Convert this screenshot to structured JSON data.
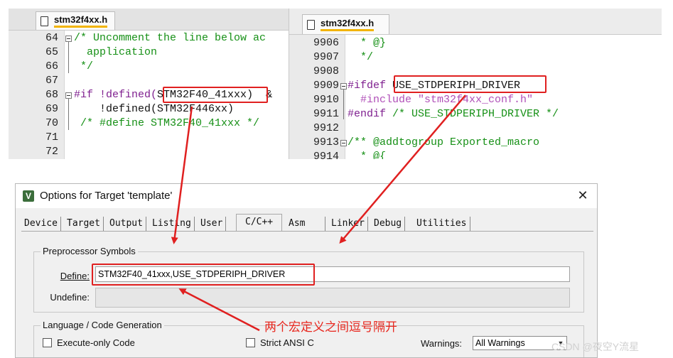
{
  "left_editor": {
    "tab": "stm32f4xx.h",
    "line_numbers": [
      "64",
      "65",
      "66",
      "67",
      "68",
      "69",
      "70",
      "71",
      "72"
    ],
    "lines": [
      {
        "pre": "",
        "comment": "/* Uncomment the line below ac"
      },
      {
        "pre": "",
        "comment": "  application"
      },
      {
        "pre": "",
        "comment": " */"
      },
      {
        "pre": "",
        "comment": ""
      },
      {
        "directive": "#if !defined(",
        "macro": "STM32F40_41xxx",
        "rest": ")  &"
      },
      {
        "pre": "    !defined(STM32F446xx)",
        "comment": ""
      },
      {
        "pre": "",
        "comment": " /* #define STM32F40_41xxx */"
      },
      {
        "pre": "",
        "comment": ""
      },
      {
        "pre": "",
        "comment": ""
      }
    ]
  },
  "right_editor": {
    "tab": "stm32f4xx.h",
    "line_numbers": [
      "9906",
      "9907",
      "9908",
      "9909",
      "9910",
      "9911",
      "9912",
      "9913",
      "9914"
    ],
    "lines": [
      {
        "text": "  * @}",
        "kind": "comment"
      },
      {
        "text": "  */",
        "kind": "comment"
      },
      {
        "text": "",
        "kind": "plain"
      },
      {
        "directive": "#ifdef ",
        "macro": "USE_STDPERIPH_DRIVER",
        "kind": "ifdef"
      },
      {
        "include_kw": "  #include ",
        "include_file": "\"stm32f4xx_conf.h\"",
        "kind": "include"
      },
      {
        "directive": "#endif ",
        "comment": "/* USE_STDPERIPH_DRIVER */",
        "kind": "endif"
      },
      {
        "text": "",
        "kind": "plain"
      },
      {
        "text": "/** @addtogroup Exported_macro",
        "kind": "comment"
      },
      {
        "text": "  * @{",
        "kind": "comment"
      }
    ]
  },
  "dialog": {
    "title": "Options for Target 'template'",
    "close_glyph": "✕",
    "tabs": [
      "Device",
      "Target",
      "Output",
      "Listing",
      "User",
      "C/C++",
      "Asm",
      "Linker",
      "Debug",
      "Utilities"
    ],
    "active_tab": "C/C++",
    "preprocessor": {
      "group_label": "Preprocessor Symbols",
      "define_label": "Define:",
      "define_value": "STM32F40_41xxx,USE_STDPERIPH_DRIVER",
      "undefine_label": "Undefine:",
      "undefine_value": ""
    },
    "language": {
      "group_label": "Language / Code Generation",
      "execute_only": "Execute-only Code",
      "strict_ansi": "Strict ANSI C",
      "warnings_label": "Warnings:",
      "warnings_value": "All Warnings"
    }
  },
  "annotation": {
    "note": "两个宏定义之间逗号隔开",
    "color": "#e8271e"
  },
  "watermark": "CSDN @夜空Y流星",
  "colors": {
    "comment": "#169016",
    "preprocessor": "#7f1f8f",
    "string": "#b04fb8",
    "tab_underline": "#f2b400",
    "annotation_red": "#e02020"
  }
}
